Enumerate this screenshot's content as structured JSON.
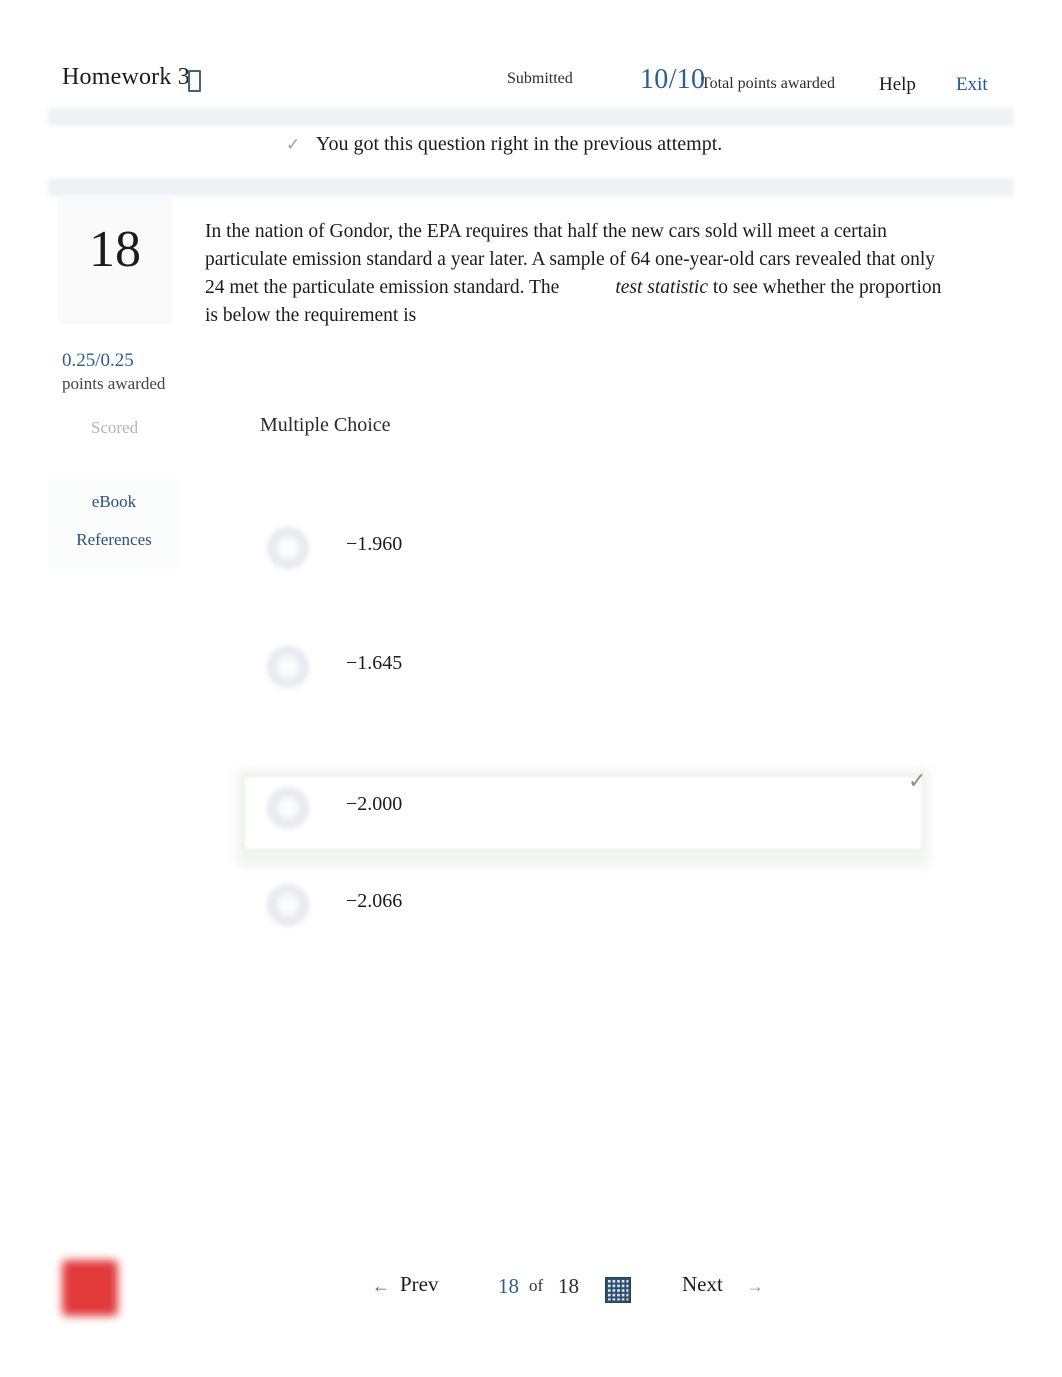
{
  "header": {
    "title": "Homework 3",
    "save_icon": "bookmark-icon",
    "status": "Submitted",
    "score": "10/10",
    "score_label": "Total points awarded",
    "help_label": "Help",
    "exit_label": "Exit"
  },
  "banner": {
    "tick": "✓",
    "message": "You got this question right in the previous attempt."
  },
  "sidebar": {
    "question_number": "18",
    "points_awarded": "0.25/0.25",
    "points_label": "points awarded",
    "scored_label": "Scored",
    "ebook_label": "eBook",
    "references_label": "References"
  },
  "question": {
    "body": "In the nation of Gondor, the EPA requires that half the new cars sold will meet a certain particulate emission standard a year later. A sample of 64 one-year-old cars revealed that only 24 met the particulate emission standard. The",
    "emphasis": "test statistic",
    "body_tail": "to see whether the proportion is below the requirement is",
    "type_label": "Multiple Choice"
  },
  "options": [
    {
      "label": "−1.960",
      "selected": false
    },
    {
      "label": "−1.645",
      "selected": false
    },
    {
      "label": "−2.000",
      "selected": true
    },
    {
      "label": "−2.066",
      "selected": false
    }
  ],
  "correct_tick": "✓",
  "footer": {
    "flag_icon": "flag-icon",
    "prev_arrow": "←",
    "prev_label": "Prev",
    "page_current": "18",
    "page_of": "of",
    "page_total": "18",
    "grid_icon": "question-grid-icon",
    "next_label": "Next",
    "next_arrow": "→"
  },
  "colors": {
    "accent_blue": "#2a5f91",
    "link_blue": "#1c5a9c",
    "strip_gray": "#eef2f6",
    "flag_red": "#e23b3b",
    "selected_green": "#f2f6f2"
  }
}
